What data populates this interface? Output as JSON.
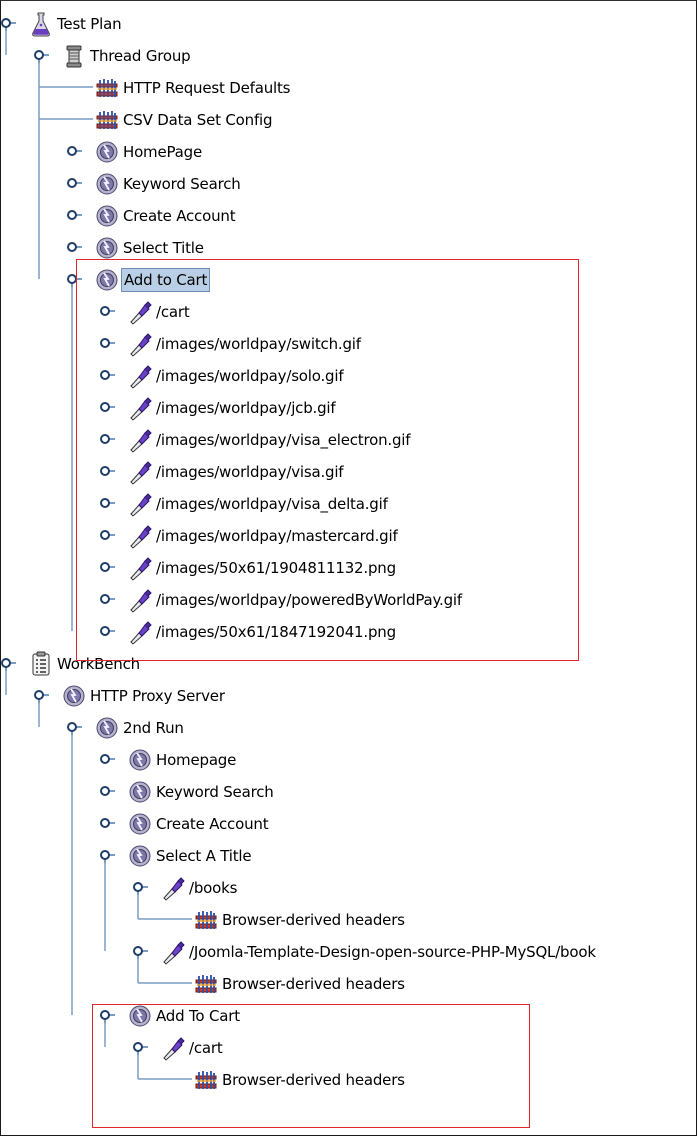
{
  "tree": [
    {
      "label": "Test Plan",
      "icon": "test-plan-icon",
      "level": 0,
      "handle": "expanded"
    },
    {
      "label": "Thread Group",
      "icon": "thread-group-icon",
      "level": 1,
      "handle": "expanded"
    },
    {
      "label": "HTTP Request Defaults",
      "icon": "config-element-icon",
      "level": 2,
      "handle": "leaf"
    },
    {
      "label": "CSV Data Set Config",
      "icon": "config-element-icon",
      "level": 2,
      "handle": "leaf"
    },
    {
      "label": "HomePage",
      "icon": "controller-icon",
      "level": 2,
      "handle": "collapsed"
    },
    {
      "label": "Keyword Search",
      "icon": "controller-icon",
      "level": 2,
      "handle": "collapsed"
    },
    {
      "label": "Create Account",
      "icon": "controller-icon",
      "level": 2,
      "handle": "collapsed"
    },
    {
      "label": "Select Title",
      "icon": "controller-icon",
      "level": 2,
      "handle": "collapsed"
    },
    {
      "label": "Add to Cart",
      "icon": "controller-icon",
      "level": 2,
      "handle": "expanded",
      "selected": true
    },
    {
      "label": "/cart",
      "icon": "sampler-icon",
      "level": 3,
      "handle": "collapsed"
    },
    {
      "label": "/images/worldpay/switch.gif",
      "icon": "sampler-icon",
      "level": 3,
      "handle": "collapsed"
    },
    {
      "label": "/images/worldpay/solo.gif",
      "icon": "sampler-icon",
      "level": 3,
      "handle": "collapsed"
    },
    {
      "label": "/images/worldpay/jcb.gif",
      "icon": "sampler-icon",
      "level": 3,
      "handle": "collapsed"
    },
    {
      "label": "/images/worldpay/visa_electron.gif",
      "icon": "sampler-icon",
      "level": 3,
      "handle": "collapsed"
    },
    {
      "label": "/images/worldpay/visa.gif",
      "icon": "sampler-icon",
      "level": 3,
      "handle": "collapsed"
    },
    {
      "label": "/images/worldpay/visa_delta.gif",
      "icon": "sampler-icon",
      "level": 3,
      "handle": "collapsed"
    },
    {
      "label": "/images/worldpay/mastercard.gif",
      "icon": "sampler-icon",
      "level": 3,
      "handle": "collapsed"
    },
    {
      "label": "/images/50x61/1904811132.png",
      "icon": "sampler-icon",
      "level": 3,
      "handle": "collapsed"
    },
    {
      "label": "/images/worldpay/poweredByWorldPay.gif",
      "icon": "sampler-icon",
      "level": 3,
      "handle": "collapsed"
    },
    {
      "label": "/images/50x61/1847192041.png",
      "icon": "sampler-icon",
      "level": 3,
      "handle": "collapsed"
    },
    {
      "label": "WorkBench",
      "icon": "workbench-icon",
      "level": 0,
      "handle": "expanded"
    },
    {
      "label": "HTTP Proxy Server",
      "icon": "controller-icon",
      "level": 1,
      "handle": "expanded"
    },
    {
      "label": "2nd Run",
      "icon": "controller-icon",
      "level": 2,
      "handle": "expanded"
    },
    {
      "label": "Homepage",
      "icon": "controller-icon",
      "level": 3,
      "handle": "collapsed"
    },
    {
      "label": "Keyword Search",
      "icon": "controller-icon",
      "level": 3,
      "handle": "collapsed"
    },
    {
      "label": "Create Account",
      "icon": "controller-icon",
      "level": 3,
      "handle": "collapsed"
    },
    {
      "label": "Select A Title",
      "icon": "controller-icon",
      "level": 3,
      "handle": "expanded"
    },
    {
      "label": "/books",
      "icon": "sampler-icon",
      "level": 4,
      "handle": "expanded"
    },
    {
      "label": "Browser-derived headers",
      "icon": "config-element-icon",
      "level": 5,
      "handle": "leaf"
    },
    {
      "label": "/Joomla-Template-Design-open-source-PHP-MySQL/book",
      "icon": "sampler-icon",
      "level": 4,
      "handle": "expanded"
    },
    {
      "label": "Browser-derived headers",
      "icon": "config-element-icon",
      "level": 5,
      "handle": "leaf"
    },
    {
      "label": "Add To Cart",
      "icon": "controller-icon",
      "level": 3,
      "handle": "expanded"
    },
    {
      "label": "/cart",
      "icon": "sampler-icon",
      "level": 4,
      "handle": "expanded"
    },
    {
      "label": "Browser-derived headers",
      "icon": "config-element-icon",
      "level": 5,
      "handle": "leaf"
    }
  ],
  "highlight_color": "#e0262a",
  "selection_color": "#b8cfe5",
  "line_color": "#7a9cc0"
}
